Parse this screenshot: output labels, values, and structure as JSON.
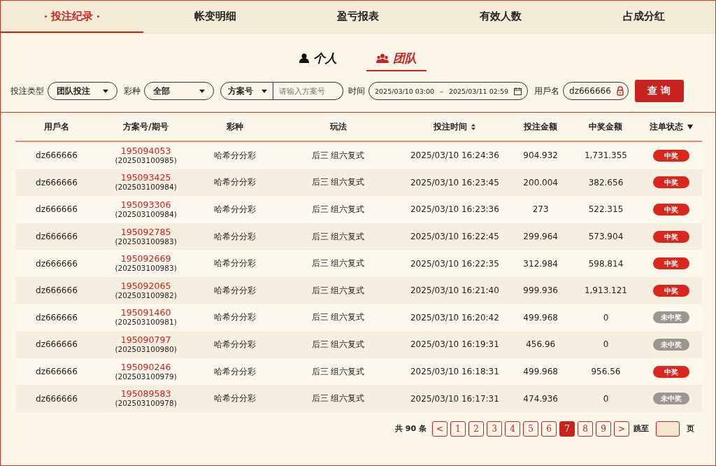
{
  "tabs": [
    {
      "label": "投注纪录",
      "selected": true
    },
    {
      "label": "帐变明细",
      "selected": false
    },
    {
      "label": "盈亏报表",
      "selected": false
    },
    {
      "label": "有效人数",
      "selected": false
    },
    {
      "label": "占成分红",
      "selected": false
    }
  ],
  "scope_tabs": [
    {
      "label": "个人",
      "kind": "person",
      "selected": false
    },
    {
      "label": "团队",
      "kind": "team",
      "selected": true
    }
  ],
  "filters": {
    "bet_type_label": "投注类型",
    "bet_type": "团队投注",
    "lottery_label": "彩种",
    "lottery": "全部",
    "plan_select": "方案号",
    "plan_placeholder": "请输入方案号",
    "time_label": "时间",
    "time_start": "2025/03/10 03:00",
    "time_sep": "–",
    "time_end": "2025/03/11 02:59",
    "user_label": "用戶名",
    "user": "dz666666",
    "query_button": "查 询"
  },
  "table": {
    "columns": [
      {
        "label": "用戶名"
      },
      {
        "label": "方案号/期号"
      },
      {
        "label": "彩种"
      },
      {
        "label": "玩法"
      },
      {
        "label": "投注时间",
        "kind": "sort"
      },
      {
        "label": "投注金额"
      },
      {
        "label": "中奖金额"
      },
      {
        "label": "注单状态",
        "kind": "filter"
      }
    ],
    "rows": [
      {
        "user": "dz666666",
        "plan": "195094053",
        "issue": "(202503100985)",
        "lottery": "哈希分分彩",
        "play": "后三 组六复式",
        "time": "2025/03/10 16:24:36",
        "bet": "904.932",
        "win": "1,731.355",
        "status": "中奖",
        "kind": "won"
      },
      {
        "user": "dz666666",
        "plan": "195093425",
        "issue": "(202503100984)",
        "lottery": "哈希分分彩",
        "play": "后三 组六复式",
        "time": "2025/03/10 16:23:45",
        "bet": "200.004",
        "win": "382.656",
        "status": "中奖",
        "kind": "won"
      },
      {
        "user": "dz666666",
        "plan": "195093306",
        "issue": "(202503100984)",
        "lottery": "哈希分分彩",
        "play": "后三 组六复式",
        "time": "2025/03/10 16:23:36",
        "bet": "273",
        "win": "522.315",
        "status": "中奖",
        "kind": "won"
      },
      {
        "user": "dz666666",
        "plan": "195092785",
        "issue": "(202503100983)",
        "lottery": "哈希分分彩",
        "play": "后三 组六复式",
        "time": "2025/03/10 16:22:45",
        "bet": "299.964",
        "win": "573.904",
        "status": "中奖",
        "kind": "won"
      },
      {
        "user": "dz666666",
        "plan": "195092669",
        "issue": "(202503100983)",
        "lottery": "哈希分分彩",
        "play": "后三 组六复式",
        "time": "2025/03/10 16:22:35",
        "bet": "312.984",
        "win": "598.814",
        "status": "中奖",
        "kind": "won"
      },
      {
        "user": "dz666666",
        "plan": "195092065",
        "issue": "(202503100982)",
        "lottery": "哈希分分彩",
        "play": "后三 组六复式",
        "time": "2025/03/10 16:21:40",
        "bet": "999.936",
        "win": "1,913.121",
        "status": "中奖",
        "kind": "won"
      },
      {
        "user": "dz666666",
        "plan": "195091460",
        "issue": "(202503100981)",
        "lottery": "哈希分分彩",
        "play": "后三 组六复式",
        "time": "2025/03/10 16:20:42",
        "bet": "499.968",
        "win": "0",
        "status": "未中奖",
        "kind": "lost"
      },
      {
        "user": "dz666666",
        "plan": "195090797",
        "issue": "(202503100980)",
        "lottery": "哈希分分彩",
        "play": "后三 组六复式",
        "time": "2025/03/10 16:19:31",
        "bet": "456.96",
        "win": "0",
        "status": "未中奖",
        "kind": "lost"
      },
      {
        "user": "dz666666",
        "plan": "195090246",
        "issue": "(202503100979)",
        "lottery": "哈希分分彩",
        "play": "后三 组六复式",
        "time": "2025/03/10 16:18:31",
        "bet": "499.968",
        "win": "956.56",
        "status": "中奖",
        "kind": "won"
      },
      {
        "user": "dz666666",
        "plan": "195089583",
        "issue": "(202503100978)",
        "lottery": "哈希分分彩",
        "play": "后三 组六复式",
        "time": "2025/03/10 16:17:31",
        "bet": "474.936",
        "win": "0",
        "status": "未中奖",
        "kind": "lost"
      }
    ]
  },
  "pagination": {
    "total": "共 90 条",
    "prev": "<",
    "pages": [
      {
        "label": "1",
        "selected": false
      },
      {
        "label": "2",
        "selected": false
      },
      {
        "label": "3",
        "selected": false
      },
      {
        "label": "4",
        "selected": false
      },
      {
        "label": "5",
        "selected": false
      },
      {
        "label": "6",
        "selected": false
      },
      {
        "label": "7",
        "selected": true
      },
      {
        "label": "8",
        "selected": false
      },
      {
        "label": "9",
        "selected": false
      }
    ],
    "next": ">",
    "jump_label": "跳至",
    "page_unit": "页"
  }
}
